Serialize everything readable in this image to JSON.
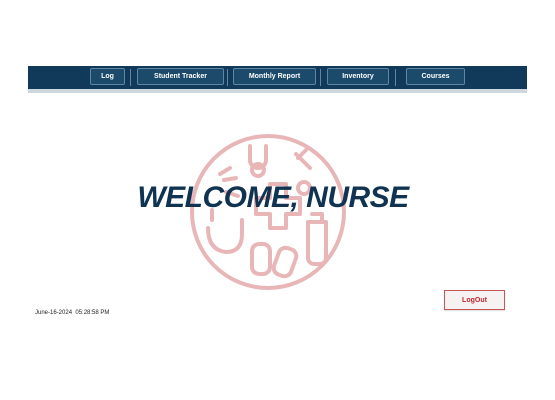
{
  "navbar": {
    "items": [
      {
        "label": "Log",
        "active": true
      },
      {
        "label": "Student Tracker"
      },
      {
        "label": "Monthly Report"
      },
      {
        "label": "Inventory"
      },
      {
        "label": "Courses"
      }
    ]
  },
  "main": {
    "welcome_text": "WELCOME, NURSE",
    "emblem_icon": "medical-emblem-icon"
  },
  "logout_label": "LogOut",
  "footer": {
    "date": "June-16-2024",
    "time": "05:28:58 PM"
  },
  "colors": {
    "navbar": "#113a5a",
    "accent_red": "#c2272d",
    "title": "#0f3350"
  }
}
